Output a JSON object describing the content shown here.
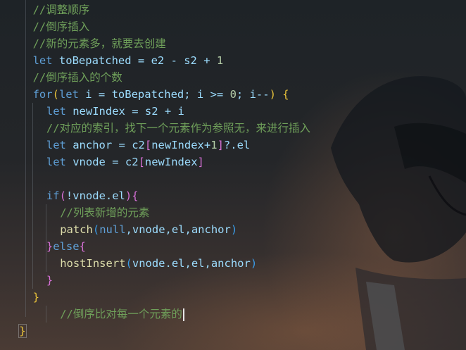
{
  "code_lines": [
    {
      "indent": 2,
      "tokens": [
        {
          "t": "//调整顺序",
          "c": "comment"
        }
      ]
    },
    {
      "indent": 2,
      "tokens": [
        {
          "t": "//倒序插入",
          "c": "comment"
        }
      ]
    },
    {
      "indent": 2,
      "tokens": [
        {
          "t": "//新的元素多，就要去创建",
          "c": "comment"
        }
      ]
    },
    {
      "indent": 2,
      "tokens": [
        {
          "t": "let",
          "c": "kw"
        },
        {
          "t": " toBepatched = e2 - s2 + ",
          "c": "var"
        },
        {
          "t": "1",
          "c": "num"
        }
      ]
    },
    {
      "indent": 2,
      "tokens": [
        {
          "t": "//倒序插入的个数",
          "c": "comment"
        }
      ]
    },
    {
      "indent": 2,
      "tokens": [
        {
          "t": "for",
          "c": "kw"
        },
        {
          "t": "(",
          "c": "paren1"
        },
        {
          "t": "let",
          "c": "kw"
        },
        {
          "t": " i = toBepatched; i >= ",
          "c": "var"
        },
        {
          "t": "0",
          "c": "num"
        },
        {
          "t": "; i--",
          "c": "var"
        },
        {
          "t": ")",
          "c": "paren1"
        },
        {
          "t": " {",
          "c": "paren1"
        }
      ]
    },
    {
      "indent": 3,
      "tokens": [
        {
          "t": "let",
          "c": "kw"
        },
        {
          "t": " newIndex = s2 + i",
          "c": "var"
        }
      ]
    },
    {
      "indent": 3,
      "tokens": [
        {
          "t": "//对应的索引，找下一个元素作为参照无，来进行插入",
          "c": "comment"
        }
      ]
    },
    {
      "indent": 3,
      "tokens": [
        {
          "t": "let",
          "c": "kw"
        },
        {
          "t": " anchor = c2",
          "c": "var"
        },
        {
          "t": "[",
          "c": "paren2"
        },
        {
          "t": "newIndex+",
          "c": "var"
        },
        {
          "t": "1",
          "c": "num"
        },
        {
          "t": "]",
          "c": "paren2"
        },
        {
          "t": "?.el",
          "c": "var"
        }
      ]
    },
    {
      "indent": 3,
      "tokens": [
        {
          "t": "let",
          "c": "kw"
        },
        {
          "t": " vnode = c2",
          "c": "var"
        },
        {
          "t": "[",
          "c": "paren2"
        },
        {
          "t": "newIndex",
          "c": "var"
        },
        {
          "t": "]",
          "c": "paren2"
        }
      ]
    },
    {
      "indent": 3,
      "tokens": []
    },
    {
      "indent": 3,
      "tokens": [
        {
          "t": "if",
          "c": "kw"
        },
        {
          "t": "(",
          "c": "paren2"
        },
        {
          "t": "!vnode.el",
          "c": "var"
        },
        {
          "t": ")",
          "c": "paren2"
        },
        {
          "t": "{",
          "c": "paren2"
        }
      ]
    },
    {
      "indent": 4,
      "tokens": [
        {
          "t": "//列表新增的元素",
          "c": "comment"
        }
      ]
    },
    {
      "indent": 4,
      "tokens": [
        {
          "t": "patch",
          "c": "fn"
        },
        {
          "t": "(",
          "c": "paren3"
        },
        {
          "t": "null",
          "c": "null"
        },
        {
          "t": ",vnode,el,anchor",
          "c": "var"
        },
        {
          "t": ")",
          "c": "paren3"
        }
      ]
    },
    {
      "indent": 3,
      "tokens": [
        {
          "t": "}",
          "c": "paren2"
        },
        {
          "t": "else",
          "c": "kw"
        },
        {
          "t": "{",
          "c": "paren2"
        }
      ]
    },
    {
      "indent": 4,
      "tokens": [
        {
          "t": "hostInsert",
          "c": "fn"
        },
        {
          "t": "(",
          "c": "paren3"
        },
        {
          "t": "vnode.el,el,anchor",
          "c": "var"
        },
        {
          "t": ")",
          "c": "paren3"
        }
      ]
    },
    {
      "indent": 3,
      "tokens": [
        {
          "t": "}",
          "c": "paren2"
        }
      ]
    },
    {
      "indent": 2,
      "tokens": [
        {
          "t": "}",
          "c": "paren1"
        }
      ]
    },
    {
      "indent": 4,
      "tokens": [
        {
          "t": "//倒序比对每一个元素的",
          "c": "comment"
        }
      ],
      "cursor": true
    },
    {
      "indent": 1,
      "tokens": [
        {
          "t": "}",
          "c": "paren1"
        }
      ],
      "boxed": true
    }
  ]
}
